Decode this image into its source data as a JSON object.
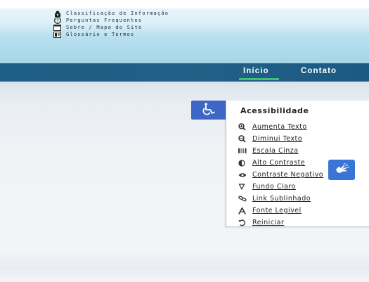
{
  "utility_links": [
    {
      "icon": "classification-icon",
      "label": "Classificação de Informação"
    },
    {
      "icon": "question-icon",
      "label": "Perguntas Frequentes"
    },
    {
      "icon": "sitemap-icon",
      "label": "Sobre / Mapa do Site"
    },
    {
      "icon": "glossary-icon",
      "label": "Glossário e Termos"
    }
  ],
  "nav": {
    "inicio": "Início",
    "contato": "Contato"
  },
  "accessibility": {
    "tab_icon": "wheelchair-icon",
    "title": "Acessibilidade",
    "items": [
      {
        "icon": "zoom-in-icon",
        "label": "Aumenta Texto"
      },
      {
        "icon": "zoom-out-icon",
        "label": "Diminui Texto"
      },
      {
        "icon": "grayscale-icon",
        "label": "Escala Cinza"
      },
      {
        "icon": "contrast-icon",
        "label": "Alto Contraste"
      },
      {
        "icon": "eye-icon",
        "label": "Contraste Negativo"
      },
      {
        "icon": "bulb-icon",
        "label": "Fundo Claro"
      },
      {
        "icon": "link-icon",
        "label": "Link Sublinhado"
      },
      {
        "icon": "font-icon",
        "label": "Fonte Legível"
      },
      {
        "icon": "reset-icon",
        "label": "Reiniciar"
      }
    ]
  },
  "vlibras": {
    "icon": "sign-language-icon"
  },
  "colors": {
    "navbar": "#215f87",
    "accent_underline": "#3fbf77",
    "accessibility_tab": "#3e67c5",
    "vlibras": "#3a75d6"
  }
}
